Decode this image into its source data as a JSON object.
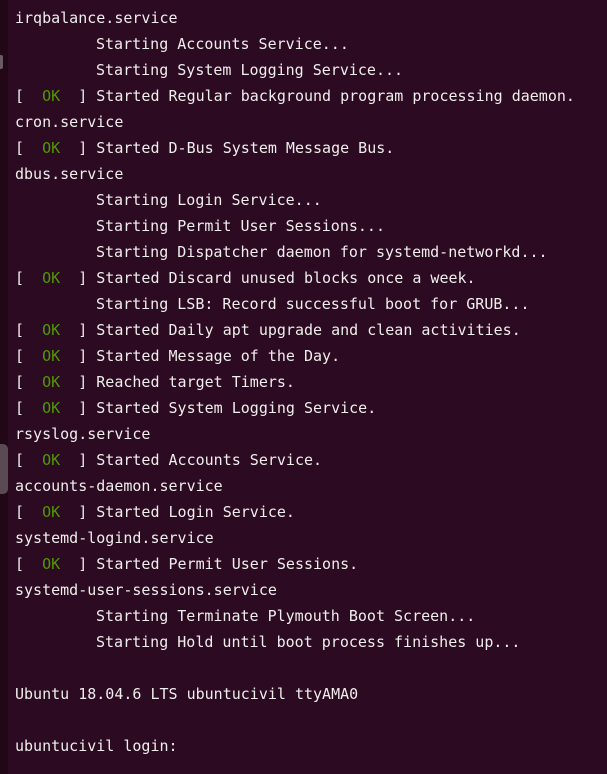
{
  "terminal": {
    "lines": [
      {
        "kind": "plain",
        "text": "irqbalance.service"
      },
      {
        "kind": "indent",
        "text": "Starting Accounts Service..."
      },
      {
        "kind": "indent",
        "text": "Starting System Logging Service..."
      },
      {
        "kind": "ok",
        "text": "Started Regular background program processing daemon."
      },
      {
        "kind": "plain",
        "text": "cron.service"
      },
      {
        "kind": "ok",
        "text": "Started D-Bus System Message Bus."
      },
      {
        "kind": "plain",
        "text": "dbus.service"
      },
      {
        "kind": "indent",
        "text": "Starting Login Service..."
      },
      {
        "kind": "indent",
        "text": "Starting Permit User Sessions..."
      },
      {
        "kind": "indent",
        "text": "Starting Dispatcher daemon for systemd-networkd..."
      },
      {
        "kind": "ok",
        "text": "Started Discard unused blocks once a week."
      },
      {
        "kind": "indent",
        "text": "Starting LSB: Record successful boot for GRUB..."
      },
      {
        "kind": "ok",
        "text": "Started Daily apt upgrade and clean activities."
      },
      {
        "kind": "ok",
        "text": "Started Message of the Day."
      },
      {
        "kind": "ok",
        "text": "Reached target Timers."
      },
      {
        "kind": "ok",
        "text": "Started System Logging Service."
      },
      {
        "kind": "plain",
        "text": "rsyslog.service"
      },
      {
        "kind": "ok",
        "text": "Started Accounts Service."
      },
      {
        "kind": "plain",
        "text": "accounts-daemon.service"
      },
      {
        "kind": "ok",
        "text": "Started Login Service."
      },
      {
        "kind": "plain",
        "text": "systemd-logind.service"
      },
      {
        "kind": "ok",
        "text": "Started Permit User Sessions."
      },
      {
        "kind": "plain",
        "text": "systemd-user-sessions.service"
      },
      {
        "kind": "indent",
        "text": "Starting Terminate Plymouth Boot Screen..."
      },
      {
        "kind": "indent",
        "text": "Starting Hold until boot process finishes up..."
      },
      {
        "kind": "blank",
        "text": ""
      },
      {
        "kind": "plain",
        "text": "Ubuntu 18.04.6 LTS ubuntucivil ttyAMA0"
      },
      {
        "kind": "blank",
        "text": ""
      },
      {
        "kind": "prompt",
        "text": "ubuntucivil login: "
      }
    ],
    "ok_bracket_open": "[  ",
    "ok_word": "OK",
    "ok_bracket_close": "  ] ",
    "colors": {
      "background": "#2c0a21",
      "foreground": "#eeeeec",
      "ok": "#4e9a06"
    }
  }
}
